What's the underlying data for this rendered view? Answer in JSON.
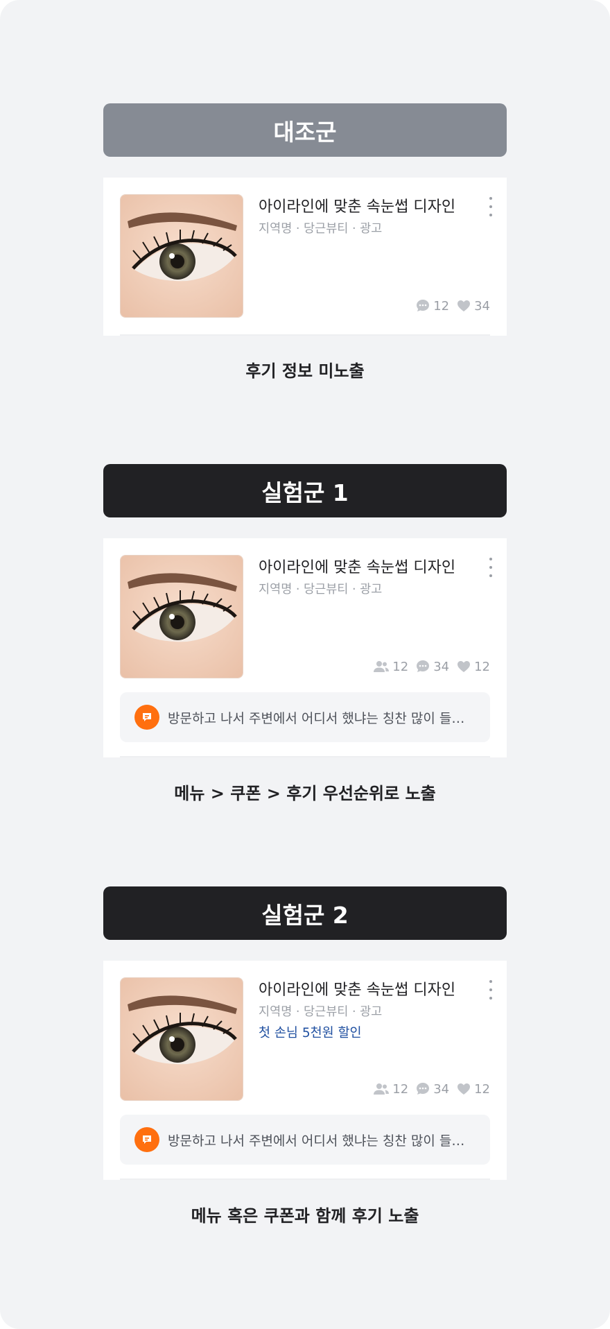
{
  "groups": [
    {
      "header": "대조군",
      "card": {
        "title": "아이라인에 맞춘 속눈썹 디자인",
        "meta": "지역명 · 당근뷰티 · 광고",
        "comments": "12",
        "likes": "34"
      },
      "caption": "후기 정보 미노출"
    },
    {
      "header": "실험군 1",
      "card": {
        "title": "아이라인에 맞춘 속눈썹 디자인",
        "meta": "지역명 · 당근뷰티 · 광고",
        "visitors": "12",
        "comments": "34",
        "likes": "12",
        "review": "방문하고 나서 주변에서 어디서 했냐는 칭찬 많이 들…"
      },
      "caption": "메뉴 > 쿠폰 > 후기 우선순위로 노출"
    },
    {
      "header": "실험군 2",
      "card": {
        "title": "아이라인에 맞춘 속눈썹 디자인",
        "meta": "지역명 · 당근뷰티 · 광고",
        "coupon": "첫 손님 5천원 할인",
        "visitors": "12",
        "comments": "34",
        "likes": "12",
        "review": "방문하고 나서 주변에서 어디서 했냐는 칭찬 많이 들…"
      },
      "caption": "메뉴 혹은 쿠폰과 함께 후기 노출"
    }
  ],
  "colors": {
    "control_header": "#868b94",
    "experiment_header": "#212124",
    "coupon_text": "#1f4fa0",
    "review_badge": "#ff6f0f"
  },
  "icons": {
    "visitors": "people-icon",
    "comments": "chat-bubble-icon",
    "likes": "heart-icon",
    "more": "more-vertical-icon",
    "review": "review-badge-icon"
  }
}
